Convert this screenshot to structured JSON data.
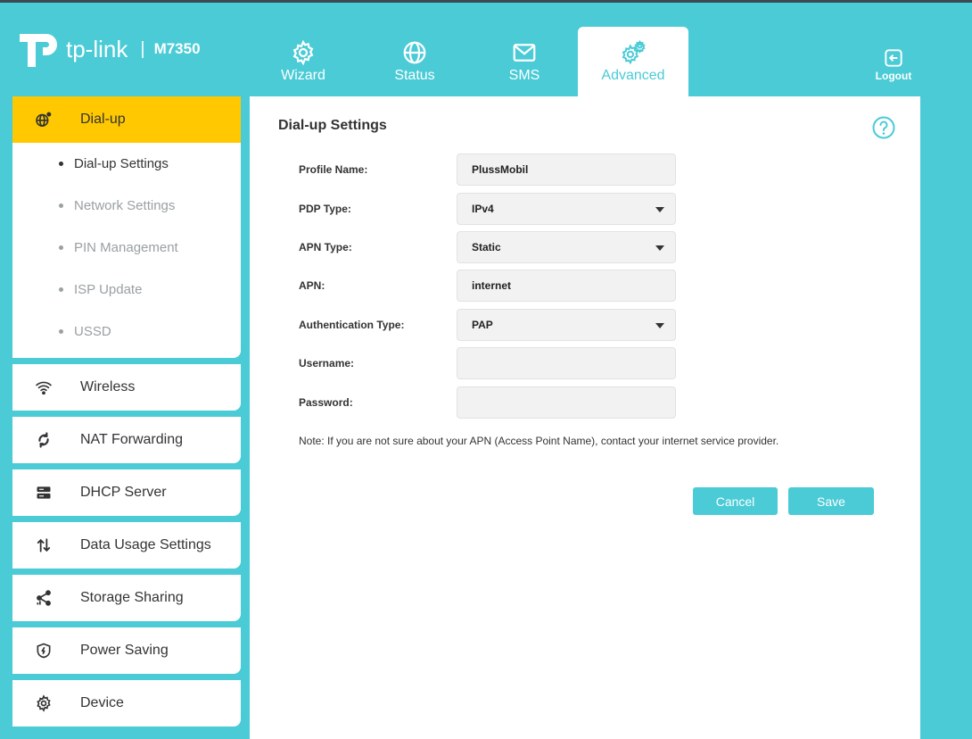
{
  "brand": {
    "name": "tp-link",
    "separator": "|",
    "model": "M7350"
  },
  "nav": {
    "tabs": [
      {
        "label": "Wizard",
        "icon": "gear-icon"
      },
      {
        "label": "Status",
        "icon": "globe-icon"
      },
      {
        "label": "SMS",
        "icon": "envelope-icon"
      },
      {
        "label": "Advanced",
        "icon": "gears-icon"
      }
    ],
    "active": "Advanced",
    "logout_label": "Logout"
  },
  "sidebar": {
    "dialup": {
      "label": "Dial-up",
      "items": [
        {
          "label": "Dial-up Settings"
        },
        {
          "label": "Network Settings"
        },
        {
          "label": "PIN Management"
        },
        {
          "label": "ISP Update"
        },
        {
          "label": "USSD"
        }
      ]
    },
    "menus": [
      {
        "label": "Wireless",
        "icon": "wifi-icon"
      },
      {
        "label": "NAT Forwarding",
        "icon": "nat-icon"
      },
      {
        "label": "DHCP Server",
        "icon": "server-icon"
      },
      {
        "label": "Data Usage Settings",
        "icon": "data-usage-icon"
      },
      {
        "label": "Storage Sharing",
        "icon": "share-icon"
      },
      {
        "label": "Power Saving",
        "icon": "power-shield-icon"
      },
      {
        "label": "Device",
        "icon": "gear-icon"
      }
    ]
  },
  "main": {
    "title": "Dial-up Settings",
    "fields": {
      "profile_name": {
        "label": "Profile Name:",
        "value": "PlussMobil"
      },
      "pdp_type": {
        "label": "PDP Type:",
        "value": "IPv4"
      },
      "apn_type": {
        "label": "APN Type:",
        "value": "Static"
      },
      "apn": {
        "label": "APN:",
        "value": "internet"
      },
      "auth_type": {
        "label": "Authentication Type:",
        "value": "PAP"
      },
      "username": {
        "label": "Username:",
        "value": ""
      },
      "password": {
        "label": "Password:",
        "value": ""
      }
    },
    "note": "Note: If you are not sure about your APN (Access Point Name), contact your internet service provider.",
    "cancel_label": "Cancel",
    "save_label": "Save"
  },
  "colors": {
    "accent": "#4acbd6",
    "highlight": "#ffc800",
    "panel": "#ffffff"
  }
}
